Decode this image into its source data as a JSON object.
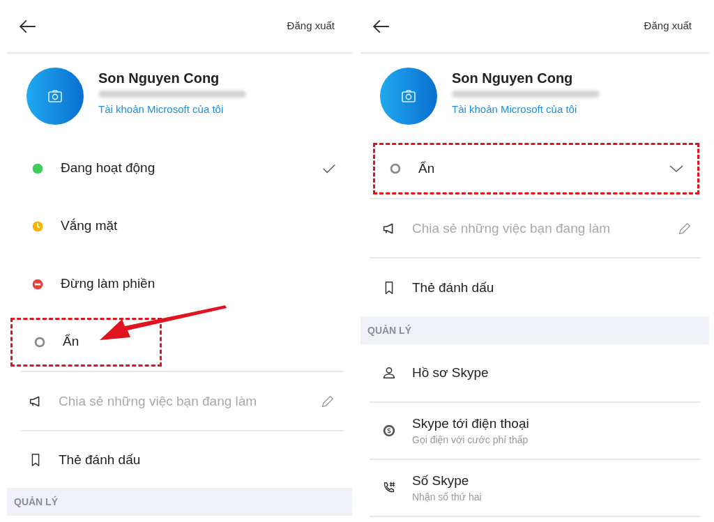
{
  "left_screen": {
    "header": {
      "logout": "Đăng xuất"
    },
    "profile": {
      "name": "Son Nguyen Cong",
      "account_link": "Tài khoản Microsoft của tôi"
    },
    "status_options": [
      {
        "kind": "online",
        "label": "Đang hoạt động",
        "selected": true,
        "highlighted": false,
        "pointed": false
      },
      {
        "kind": "away",
        "label": "Vắng mặt",
        "selected": false,
        "highlighted": false,
        "pointed": false
      },
      {
        "kind": "dnd",
        "label": "Đừng làm phiền",
        "selected": false,
        "highlighted": false,
        "pointed": false
      },
      {
        "kind": "invisible",
        "label": "Ẩn",
        "selected": false,
        "highlighted": true,
        "pointed": true
      }
    ],
    "items": [
      {
        "kind": "share",
        "label": "Chia sẻ những việc bạn đang làm"
      },
      {
        "kind": "bookmark",
        "label": "Thẻ đánh dấu"
      }
    ],
    "section": "QUẢN LÝ"
  },
  "right_screen": {
    "header": {
      "logout": "Đăng xuất"
    },
    "profile": {
      "name": "Son Nguyen Cong",
      "account_link": "Tài khoản Microsoft của tôi"
    },
    "current_status": {
      "kind": "invisible",
      "label": "Ẩn",
      "expanded": false,
      "highlighted": true
    },
    "items": [
      {
        "kind": "share",
        "label": "Chia sẻ những việc bạn đang làm"
      },
      {
        "kind": "bookmark",
        "label": "Thẻ đánh dấu"
      }
    ],
    "section": "QUẢN LÝ",
    "manage_items": [
      {
        "kind": "profile",
        "label": "Hồ sơ Skype"
      },
      {
        "kind": "skype-out",
        "label": "Skype tới điện thoại",
        "subtitle": "Gọi điện với cước phí thấp"
      },
      {
        "kind": "skype-number",
        "label": "Số Skype",
        "subtitle": "Nhận số thứ hai"
      }
    ]
  }
}
